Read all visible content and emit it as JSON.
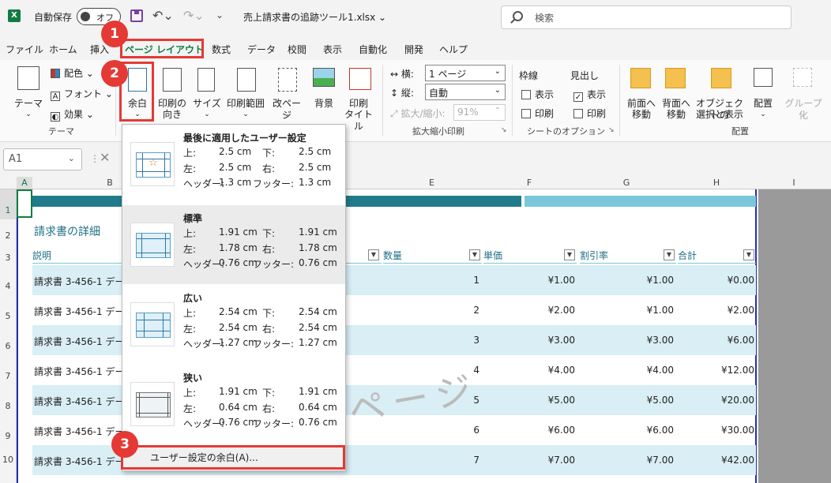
{
  "titlebar": {
    "app_logo": "X",
    "autosave_label": "自動保存",
    "toggle_label": "オフ",
    "filename": "売上請求書の追跡ツール1.xlsx ⌄",
    "search_placeholder": "検索",
    "icons": [
      "excel-logo-icon",
      "save-icon",
      "undo-icon",
      "redo-icon",
      "search-icon"
    ]
  },
  "menu": {
    "tabs": [
      "ファイル",
      "ホーム",
      "挿入",
      "ページ レイアウト",
      "数式",
      "データ",
      "校閲",
      "表示",
      "自動化",
      "開発",
      "ヘルプ"
    ],
    "active": "ページ レイアウト"
  },
  "ribbon": {
    "theme": {
      "label": "テーマ",
      "colors": "配色",
      "fonts": "フォント",
      "effects": "効果",
      "group": "テーマ"
    },
    "margins": {
      "label": "余白"
    },
    "orientation": {
      "label1": "印刷の",
      "label2": "向き"
    },
    "size": {
      "label": "サイズ"
    },
    "print_area": {
      "label": "印刷範囲"
    },
    "breaks": {
      "label": "改ページ"
    },
    "background": {
      "label": "背景"
    },
    "print_titles": {
      "label1": "印刷",
      "label2": "タイトル"
    },
    "scale": {
      "width_label": "横:",
      "width_value": "1 ページ",
      "height_label": "縦:",
      "height_value": "自動",
      "scale_label": "拡大/縮小:",
      "scale_value": "91%",
      "group": "拡大縮小印刷"
    },
    "sheet_options": {
      "gridlines": "枠線",
      "headings": "見出し",
      "view": "表示",
      "print": "印刷",
      "group": "シートのオプション"
    },
    "arrange": {
      "bring_forward1": "前面へ",
      "bring_forward2": "移動",
      "send_backward1": "背面へ",
      "send_backward2": "移動",
      "selection_pane1": "オブジェクトの",
      "selection_pane2": "選択と表示",
      "align": "配置",
      "group_btn": "グループ化",
      "group": "配置"
    }
  },
  "formula_bar": {
    "name_box": "A1"
  },
  "grid": {
    "columns": [
      "A",
      "B",
      "E",
      "F",
      "G",
      "H",
      "I"
    ],
    "rows": [
      "1",
      "2",
      "3",
      "4",
      "5",
      "6",
      "7",
      "8",
      "9",
      "10"
    ],
    "title": "請求書の詳細",
    "headers": {
      "desc": "説明",
      "qty": "数量",
      "price": "単価",
      "discount": "割引率",
      "total": "合計"
    },
    "data": [
      {
        "desc": "請求書 3-456-1 デー",
        "qty": "1",
        "price": "¥1.00",
        "discount": "¥1.00",
        "total": "¥0.00"
      },
      {
        "desc": "請求書 3-456-1 デー",
        "qty": "2",
        "price": "¥2.00",
        "discount": "¥1.00",
        "total": "¥2.00"
      },
      {
        "desc": "請求書 3-456-1 デー",
        "qty": "3",
        "price": "¥3.00",
        "discount": "¥3.00",
        "total": "¥6.00"
      },
      {
        "desc": "請求書 3-456-1 デー",
        "qty": "4",
        "price": "¥4.00",
        "discount": "¥4.00",
        "total": "¥12.00"
      },
      {
        "desc": "請求書 3-456-1 デー",
        "qty": "5",
        "price": "¥5.00",
        "discount": "¥5.00",
        "total": "¥20.00"
      },
      {
        "desc": "請求書 3-456-1 デー",
        "qty": "6",
        "price": "¥6.00",
        "discount": "¥6.00",
        "total": "¥30.00"
      },
      {
        "desc": "請求書 3-456-1 デー",
        "qty": "7",
        "price": "¥7.00",
        "discount": "¥7.00",
        "total": "¥42.00"
      }
    ],
    "watermark": "ページ"
  },
  "margins_menu": {
    "options": [
      {
        "title": "最後に適用したユーザー設定",
        "top_l": "上:",
        "top": "2.5 cm",
        "bottom_l": "下:",
        "bottom": "2.5 cm",
        "left_l": "左:",
        "left": "2.5 cm",
        "right_l": "右:",
        "right": "2.5 cm",
        "header_l": "ヘッダー:",
        "header": "1.3 cm",
        "footer_l": "フッター:",
        "footer": "1.3 cm"
      },
      {
        "title": "標準",
        "top_l": "上:",
        "top": "1.91 cm",
        "bottom_l": "下:",
        "bottom": "1.91 cm",
        "left_l": "左:",
        "left": "1.78 cm",
        "right_l": "右:",
        "right": "1.78 cm",
        "header_l": "ヘッダー:",
        "header": "0.76 cm",
        "footer_l": "フッター:",
        "footer": "0.76 cm"
      },
      {
        "title": "広い",
        "top_l": "上:",
        "top": "2.54 cm",
        "bottom_l": "下:",
        "bottom": "2.54 cm",
        "left_l": "左:",
        "left": "2.54 cm",
        "right_l": "右:",
        "right": "2.54 cm",
        "header_l": "ヘッダー:",
        "header": "1.27 cm",
        "footer_l": "フッター:",
        "footer": "1.27 cm"
      },
      {
        "title": "狭い",
        "top_l": "上:",
        "top": "1.91 cm",
        "bottom_l": "下:",
        "bottom": "1.91 cm",
        "left_l": "左:",
        "left": "0.64 cm",
        "right_l": "右:",
        "right": "0.64 cm",
        "header_l": "ヘッダー:",
        "header": "0.76 cm",
        "footer_l": "フッター:",
        "footer": "0.76 cm"
      }
    ],
    "custom": "ユーザー設定の余白(A)..."
  },
  "annotations": {
    "step1": "1",
    "step2": "2",
    "step3": "3",
    "color": "#e53935"
  }
}
